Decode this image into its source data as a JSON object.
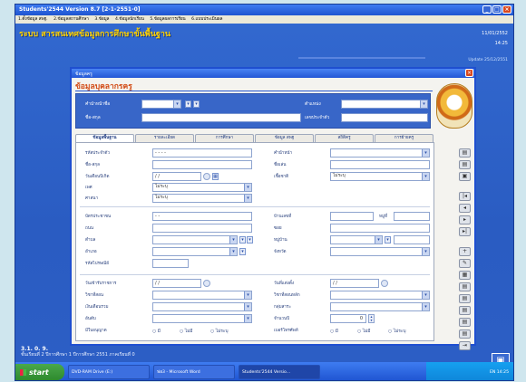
{
  "window": {
    "title": "Students'2544 Version 8.7 [2-1-2551-0]"
  },
  "menu": [
    "1.ตั้งข้อมูล สพฐ.",
    "2.ข้อมูลสถานศึกษา",
    "3.ข้อมูล",
    "4.ข้อมูลนักเรียน",
    "5.ข้อมูลผลการเรียน",
    "6.แบบประเมินผล"
  ],
  "app": {
    "heading": "ระบบ สารสนเทศข้อมูลการศึกษาขั้นพื้นฐาน",
    "date": "11/01/2552",
    "time": "14:25",
    "update": "Update 25/12/2551",
    "status_line1": "3.1. 0. 9.",
    "status_line2": "ชั้นเรียนที่ 2  ปีการศึกษา 1  ปีการศึกษา 2551  ภาคเรียนที่  0"
  },
  "dialog": {
    "title": "ข้อมูลครู",
    "heading": "ข้อมูลบุคลากรครู",
    "top": {
      "prefix_label": "คำนำหน้าชื่อ",
      "name_label": "ชื่อ-สกุล",
      "position_label": "ตำแหน่ง",
      "status_label": "เลขประจำตัว"
    },
    "tabs": [
      "ข้อมูลพื้นฐาน",
      "รายละเอียด",
      "การศึกษา",
      "ข้อมูล สพฐ",
      "สถิติครู",
      "การย้ายครู"
    ],
    "fields": {
      "id_label": "รหัสประจำตัว",
      "id_value": "- - - -",
      "name_label": "ชื่อ-สกุล",
      "birth_label": "วันเดือนปีเกิด",
      "birth_value": "/ /",
      "gender_label": "เพศ",
      "gender_value": "ไม่ระบุ",
      "blood_label": "ศาสนา",
      "blood_value": "ไม่ระบุ",
      "title_label": "คำนำหน้า",
      "nick_label": "ชื่อเล่น",
      "race_label": "เชื้อชาติ",
      "race_value": "ไม่ระบุ",
      "card_label": "บัตรประชาชน",
      "card_value": "- -",
      "road_label": "ถนน",
      "subdistrict_label": "ตำบล",
      "district_label": "อำเภอ",
      "postcode_label": "รหัสไปรษณีย์",
      "houseno_label": "บ้านเลขที่",
      "moo_label": "หมู่ที่",
      "soi_label": "ซอย",
      "village_label": "หมู่บ้าน",
      "province_label": "จังหวัด",
      "start_label": "วันเข้ารับราชการ",
      "start_value": "/ /",
      "subject_label": "วิชาที่สอน",
      "salary_label": "เงินเดือนรวม",
      "level_label": "อันดับ",
      "license_label": "มีใบอนุญาต",
      "appoint_label": "วันที่แต่งตั้ง",
      "appoint_value": "/ /",
      "teach_label": "วิชาที่สอนหลัก",
      "work_label": "กลุ่มสาระ",
      "years_label": "จำนวนปี",
      "years_value": "0",
      "phone_label": "เบอร์โทรศัพท์",
      "r1": "มี",
      "r2": "ไม่มี",
      "r3": "ไม่ระบุ"
    }
  },
  "taskbar": {
    "start": "start",
    "tasks": [
      "DVD-RAM Drive (E:)",
      "ฟอ3 - Microsoft Word",
      "Students'2544 Versio..."
    ],
    "tray": "EN  14:25"
  }
}
